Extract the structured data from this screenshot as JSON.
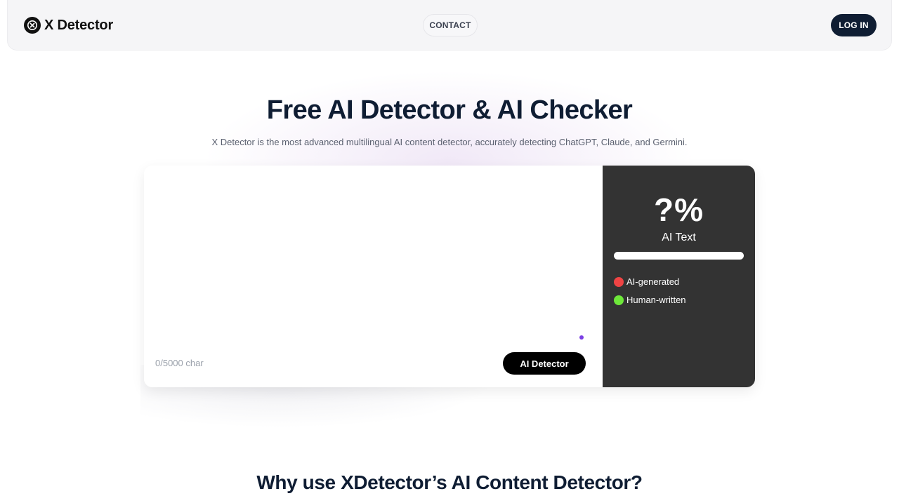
{
  "header": {
    "logo_text": "X Detector",
    "nav_contact": "CONTACT",
    "login_label": "LOG IN"
  },
  "hero": {
    "title": "Free AI Detector & AI Checker",
    "subtitle": "X Detector is the most advanced multilingual AI content detector, accurately detecting ChatGPT, Claude, and Germini."
  },
  "detector": {
    "input_value": "",
    "char_count": "0/5000 char",
    "button_label": "AI Detector",
    "result": {
      "percent": "?%",
      "label": "AI Text",
      "ai_fraction": 0,
      "legend": [
        {
          "label": "AI-generated",
          "color": "#ef4444"
        },
        {
          "label": "Human-written",
          "color": "#6ee83a"
        }
      ]
    }
  },
  "section": {
    "title": "Why use XDetector’s AI Content Detector?"
  },
  "colors": {
    "brand_dark": "#0f1d33",
    "panel_bg": "#333333",
    "accent_dot": "#7b3fe4"
  }
}
